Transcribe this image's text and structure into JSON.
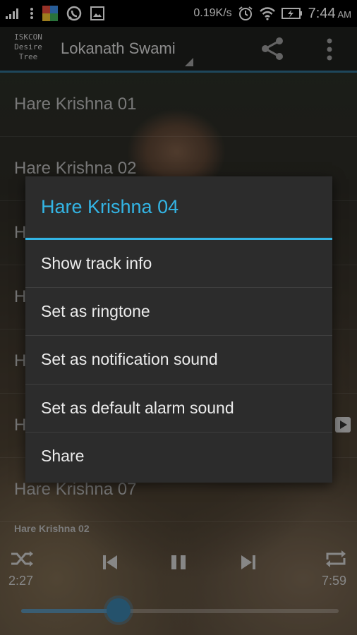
{
  "status_bar": {
    "network_speed": "0.19K/s",
    "time": "7:44",
    "ampm": "AM"
  },
  "app_bar": {
    "logo_lines": [
      "ISKCON",
      "Desire",
      "Tree"
    ],
    "title": "Lokanath Swami"
  },
  "track_list": {
    "items": [
      {
        "label": "Hare Krishna 01"
      },
      {
        "label": "Hare Krishna 02"
      },
      {
        "label": "H"
      },
      {
        "label": "H"
      },
      {
        "label": "H"
      },
      {
        "label": "H"
      },
      {
        "label": "Hare Krishna 07"
      }
    ]
  },
  "player": {
    "now_playing": "Hare Krishna 02",
    "elapsed": "2:27",
    "duration": "7:59",
    "progress_fraction": 0.307,
    "accent_color": "#3a7ea6"
  },
  "dialog": {
    "title": "Hare Krishna 04",
    "title_color": "#33b5e5",
    "items": [
      {
        "label": "Show track info"
      },
      {
        "label": "Set as ringtone"
      },
      {
        "label": "Set as notification sound"
      },
      {
        "label": "Set as default alarm sound"
      },
      {
        "label": "Share"
      }
    ]
  },
  "icons": {
    "status_left": [
      "signal-icon",
      "overflow-dots-icon",
      "app-icon",
      "whatsapp-icon",
      "image-icon"
    ],
    "status_right": [
      "alarm-icon",
      "wifi-icon",
      "battery-icon"
    ],
    "app_bar": [
      "share-icon",
      "overflow-menu-icon"
    ],
    "player": [
      "shuffle-icon",
      "previous-icon",
      "pause-icon",
      "next-icon",
      "repeat-icon"
    ]
  }
}
